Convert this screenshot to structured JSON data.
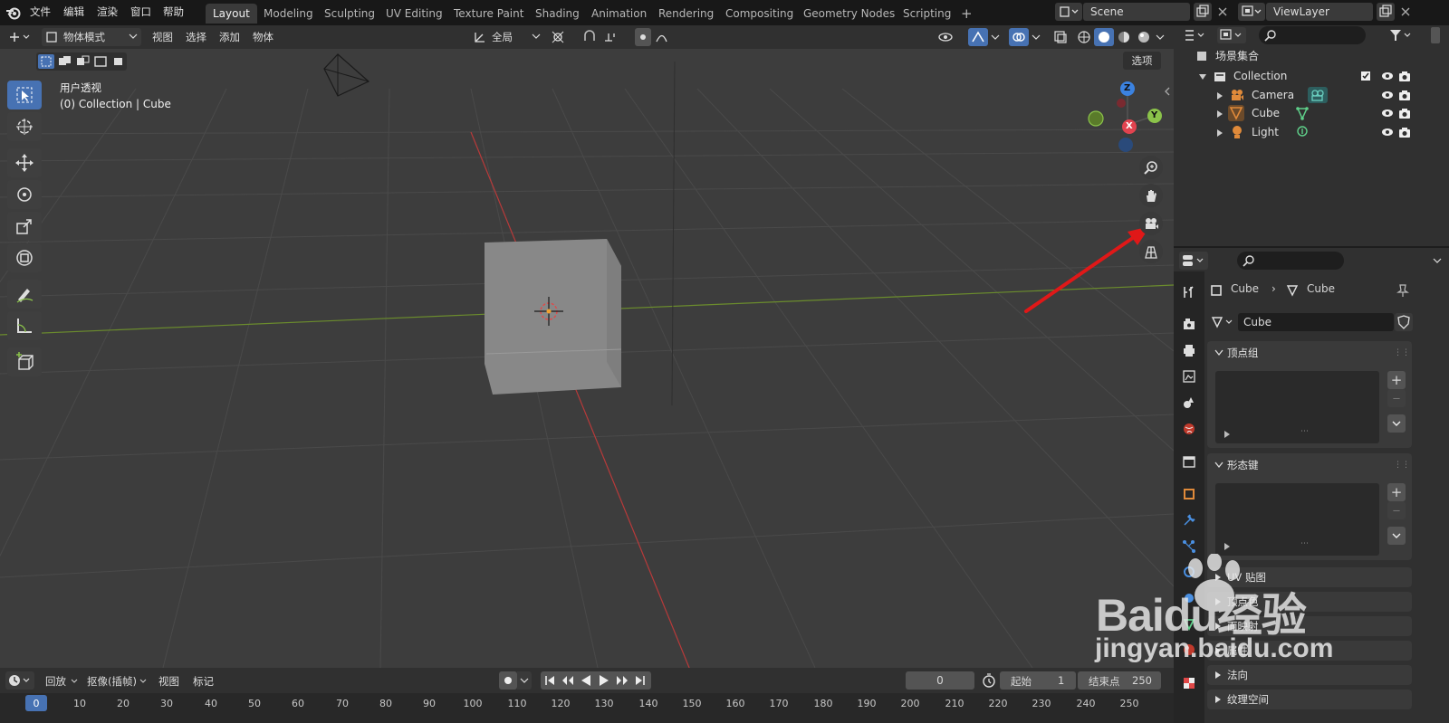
{
  "topbar": {
    "menus": [
      "文件",
      "编辑",
      "渲染",
      "窗口",
      "帮助"
    ],
    "workspaces": [
      "Layout",
      "Modeling",
      "Sculpting",
      "UV Editing",
      "Texture Paint",
      "Shading",
      "Animation",
      "Rendering",
      "Compositing",
      "Geometry Nodes",
      "Scripting"
    ],
    "active_workspace": "Layout",
    "add_tab": "+",
    "scene": "Scene",
    "view_layer": "ViewLayer"
  },
  "viewport": {
    "mode": "物体模式",
    "menus": [
      "视图",
      "选择",
      "添加",
      "物体"
    ],
    "transform_orientation": "全局",
    "options_label": "选项",
    "overlay_title": "用户透视",
    "overlay_subtitle": "(0) Collection | Cube",
    "gizmo_axes": {
      "x": "X",
      "y": "Y",
      "z": "Z"
    }
  },
  "outliner": {
    "scene_collection": "场景集合",
    "collection": "Collection",
    "objects": [
      "Camera",
      "Cube",
      "Light"
    ]
  },
  "properties": {
    "breadcrumb_object": "Cube",
    "breadcrumb_data": "Cube",
    "mesh_name": "Cube",
    "panels": [
      "顶点组",
      "形态键",
      "UV 贴图",
      "顶点色",
      "面映射",
      "属性",
      "法向",
      "纹理空间"
    ]
  },
  "timeline": {
    "menus": [
      "回放",
      "抠像(插帧)",
      "视图",
      "标记"
    ],
    "current_frame": "0",
    "start_label": "起始",
    "start_value": "1",
    "end_label": "结束点",
    "end_value": "250",
    "ticks": [
      "0",
      "10",
      "20",
      "30",
      "40",
      "50",
      "60",
      "70",
      "80",
      "90",
      "100",
      "110",
      "120",
      "130",
      "140",
      "150",
      "160",
      "170",
      "180",
      "190",
      "200",
      "210",
      "220",
      "230",
      "240",
      "250"
    ]
  },
  "watermark": {
    "brand": "Baidu经验",
    "url": "jingyan.baidu.com"
  },
  "colors": {
    "accent": "#4772b3",
    "x_axis": "#e2434f",
    "y_axis": "#8bc34a",
    "z_axis": "#3b82e0",
    "arrow": "#e01818"
  }
}
